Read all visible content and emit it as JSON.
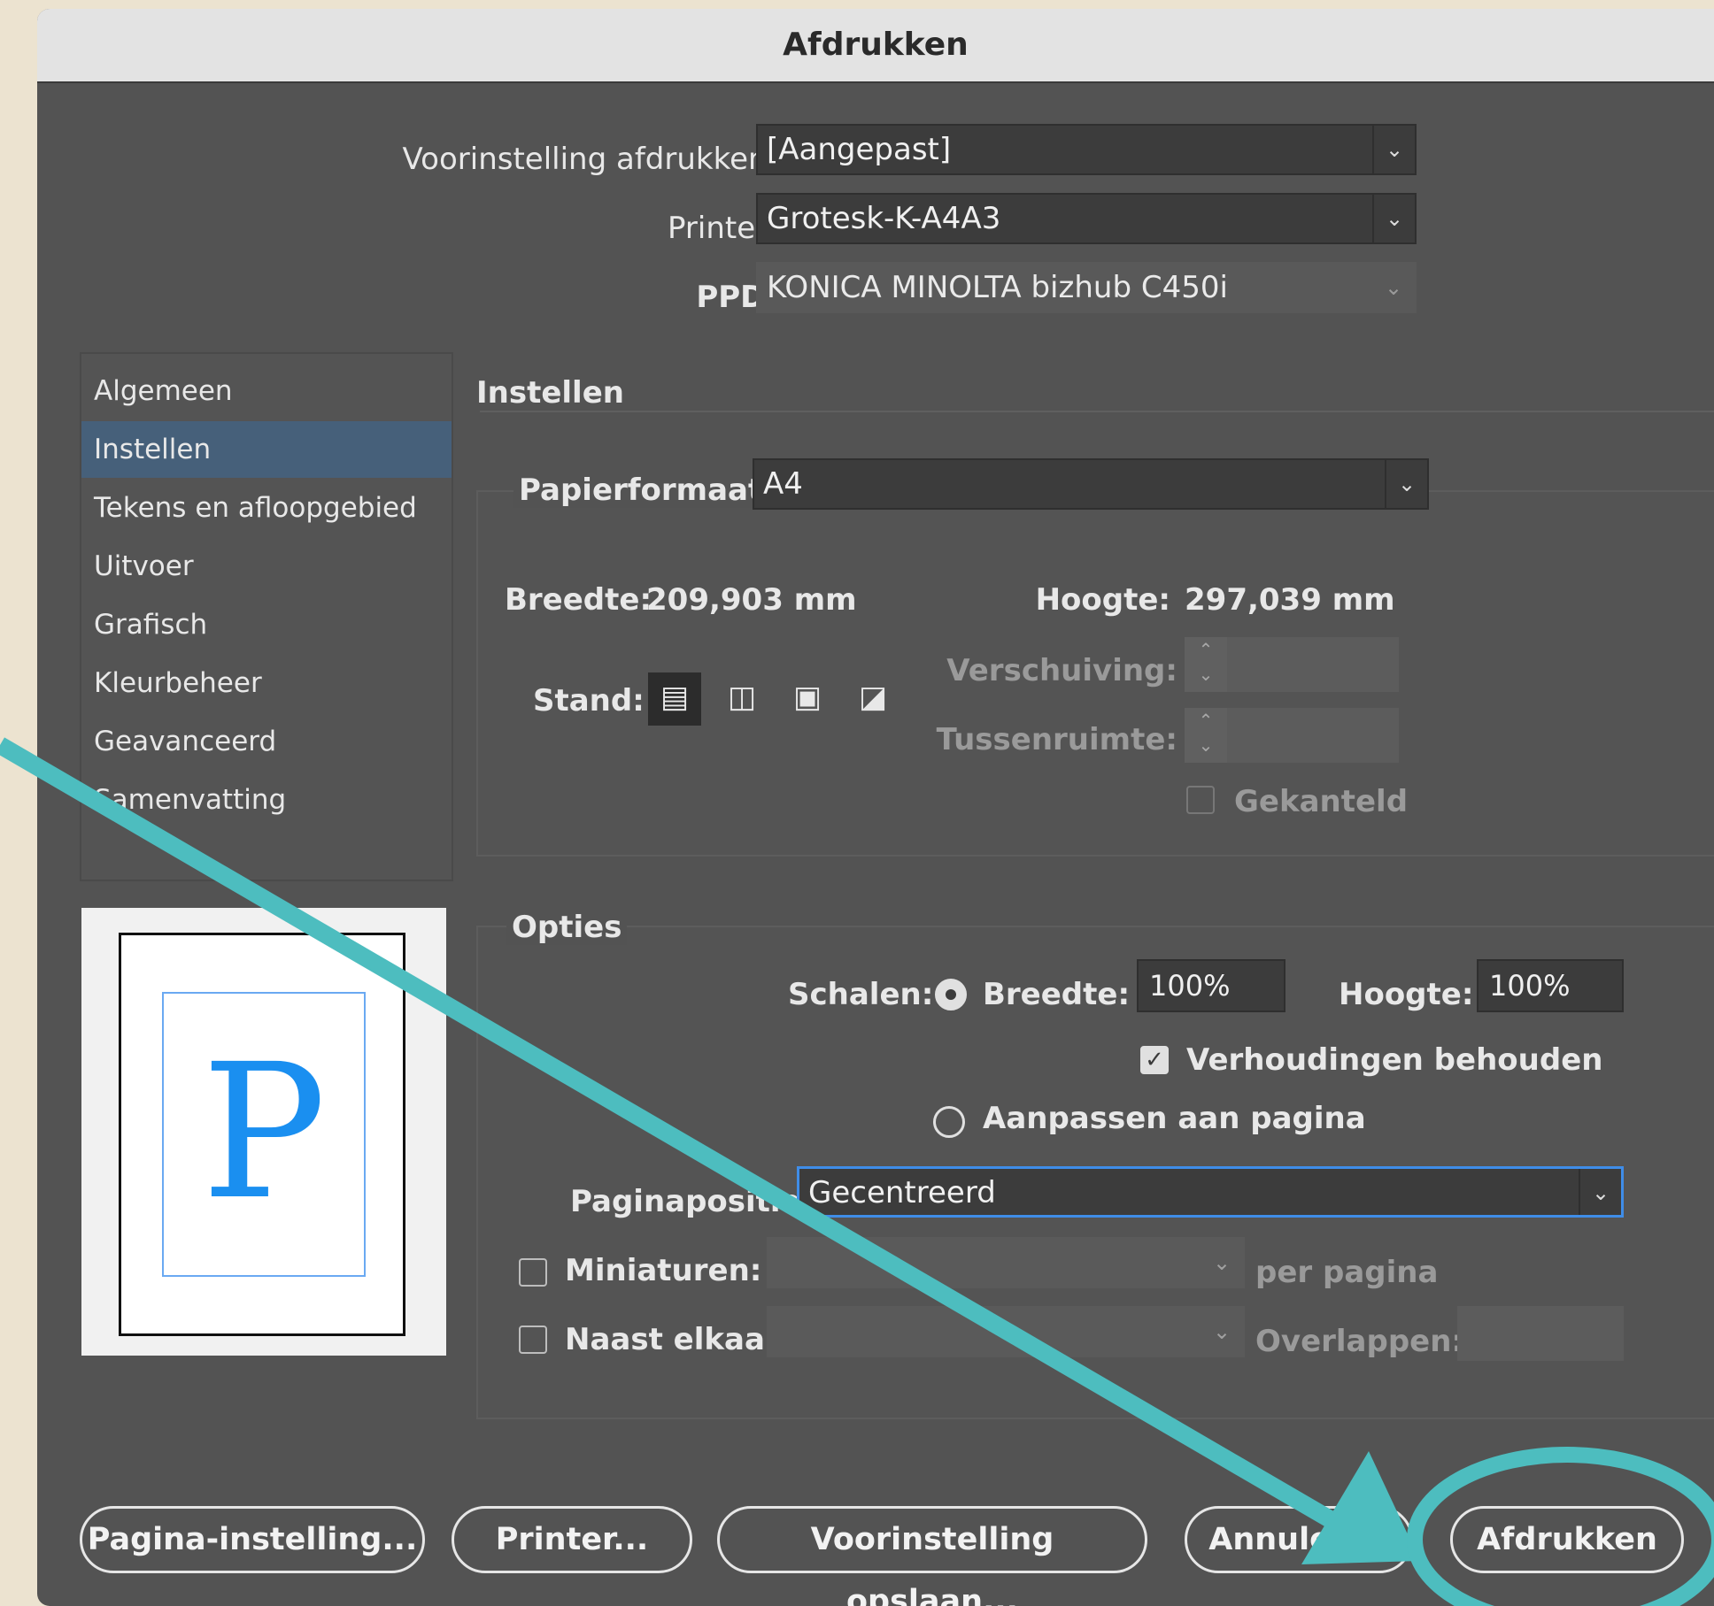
{
  "dialog": {
    "title": "Afdrukken"
  },
  "header": {
    "preset_label": "Voorinstelling afdrukken:",
    "preset_value": "[Aangepast]",
    "printer_label": "Printer:",
    "printer_value": "Grotesk-K-A4A3",
    "ppd_label": "PPD:",
    "ppd_value": "KONICA MINOLTA bizhub C450i"
  },
  "sidebar": {
    "items": [
      {
        "label": "Algemeen"
      },
      {
        "label": "Instellen"
      },
      {
        "label": "Tekens en afloopgebied"
      },
      {
        "label": "Uitvoer"
      },
      {
        "label": "Grafisch"
      },
      {
        "label": "Kleurbeheer"
      },
      {
        "label": "Geavanceerd"
      },
      {
        "label": "Samenvatting"
      }
    ],
    "active": "Instellen"
  },
  "preview": {
    "letter": "P"
  },
  "setup": {
    "section_title": "Instellen",
    "paper_label": "Papierformaat:",
    "paper_value": "A4",
    "width_label": "Breedte:",
    "width_value": "209,903 mm",
    "height_label": "Hoogte:",
    "height_value": "297,039 mm",
    "orientation_label": "Stand:",
    "offset_label": "Verschuiving:",
    "gap_label": "Tussenruimte:",
    "transverse_label": "Gekanteld"
  },
  "options": {
    "section_title": "Opties",
    "scale_label": "Schalen:",
    "scale_width_label": "Breedte:",
    "scale_width_value": "100%",
    "scale_height_label": "Hoogte:",
    "scale_height_value": "100%",
    "keep_proportions_label": "Verhoudingen behouden",
    "fit_page_label": "Aanpassen aan pagina",
    "page_position_label": "Paginapositie:",
    "page_position_value": "Gecentreerd",
    "thumbnails_label": "Miniaturen:",
    "per_page_label": "per pagina",
    "tile_label": "Naast elkaar:",
    "overlap_label": "Overlappen:"
  },
  "buttons": {
    "page_setup": "Pagina-instelling...",
    "printer": "Printer...",
    "save_preset": "Voorinstelling opslaan...",
    "cancel": "Annuleren",
    "print": "Afdrukken"
  },
  "colors": {
    "dialog_bg": "#535353",
    "selection": "#46607a",
    "focus": "#3f8de8",
    "annotation": "#4dbdbf",
    "preview_letter": "#1a8ff0"
  }
}
